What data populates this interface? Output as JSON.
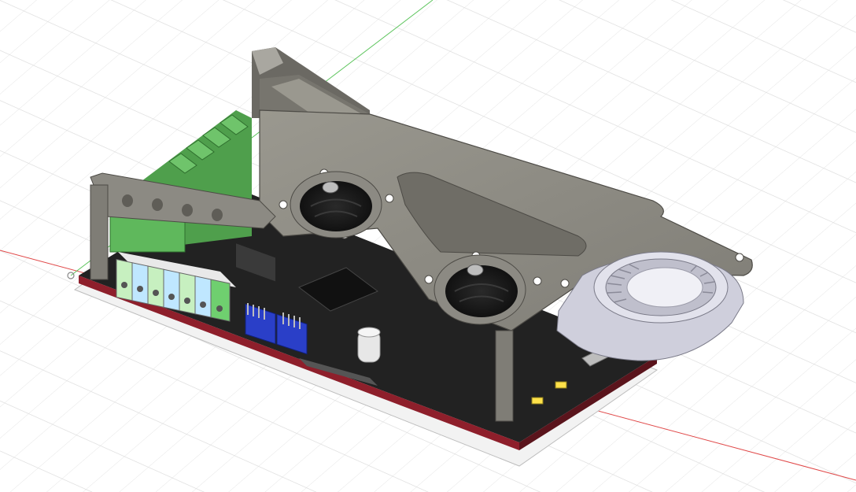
{
  "viewport": {
    "background": "#ffffff",
    "grid_color": "#dcdcdc",
    "axis_x_color": "#e04848",
    "axis_y_color": "#5cc45c"
  },
  "model": {
    "board": {
      "pcb_color": "#222222",
      "pcb_edge": "#8e1f2b",
      "pad_color": "#e9e9e9"
    },
    "case": {
      "color": "#8c8a83",
      "shadow": "#6b6963",
      "highlight": "#a9a7a0"
    },
    "terminal_blocks": {
      "colors": [
        "#c7f0c0",
        "#bfe7ff",
        "#c7f0c0",
        "#bfe7ff",
        "#c7f0c0",
        "#bfe7ff",
        "#6fcf6f"
      ]
    },
    "heatsinks": {
      "color": "#57b055"
    },
    "jumpers": {
      "color": "#2a3fc8"
    },
    "blower_fan": {
      "color": "#d4d4e0"
    },
    "axial_fans": {
      "count": 2
    },
    "leds": {
      "color": "#ffe14a"
    }
  }
}
